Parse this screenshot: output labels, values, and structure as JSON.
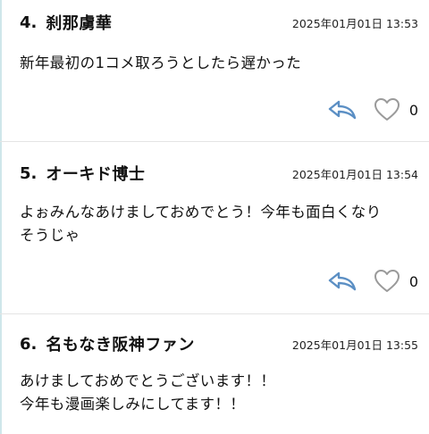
{
  "colors": {
    "reply_icon": "#5b8fc4",
    "like_icon": "#9a9a9a",
    "accent_line": "#cfe6ea"
  },
  "comments": [
    {
      "number": "4.",
      "author": "刹那虜華",
      "timestamp": "2025年01月01日 13:53",
      "body": "新年最初の1コメ取ろうとしたら遅かった",
      "reply_icon": "reply-arrow-icon",
      "like_icon": "heart-outline-icon",
      "like_count": "0"
    },
    {
      "number": "5.",
      "author": "オーキド博士",
      "timestamp": "2025年01月01日 13:54",
      "body": "よぉみんなあけましておめでとう！今年も面白くなり\nそうじゃ",
      "reply_icon": "reply-arrow-icon",
      "like_icon": "heart-outline-icon",
      "like_count": "0"
    },
    {
      "number": "6.",
      "author": "名もなき阪神ファン",
      "timestamp": "2025年01月01日 13:55",
      "body": "あけましておめでとうございます！！\n今年も漫画楽しみにしてます！！"
    }
  ]
}
